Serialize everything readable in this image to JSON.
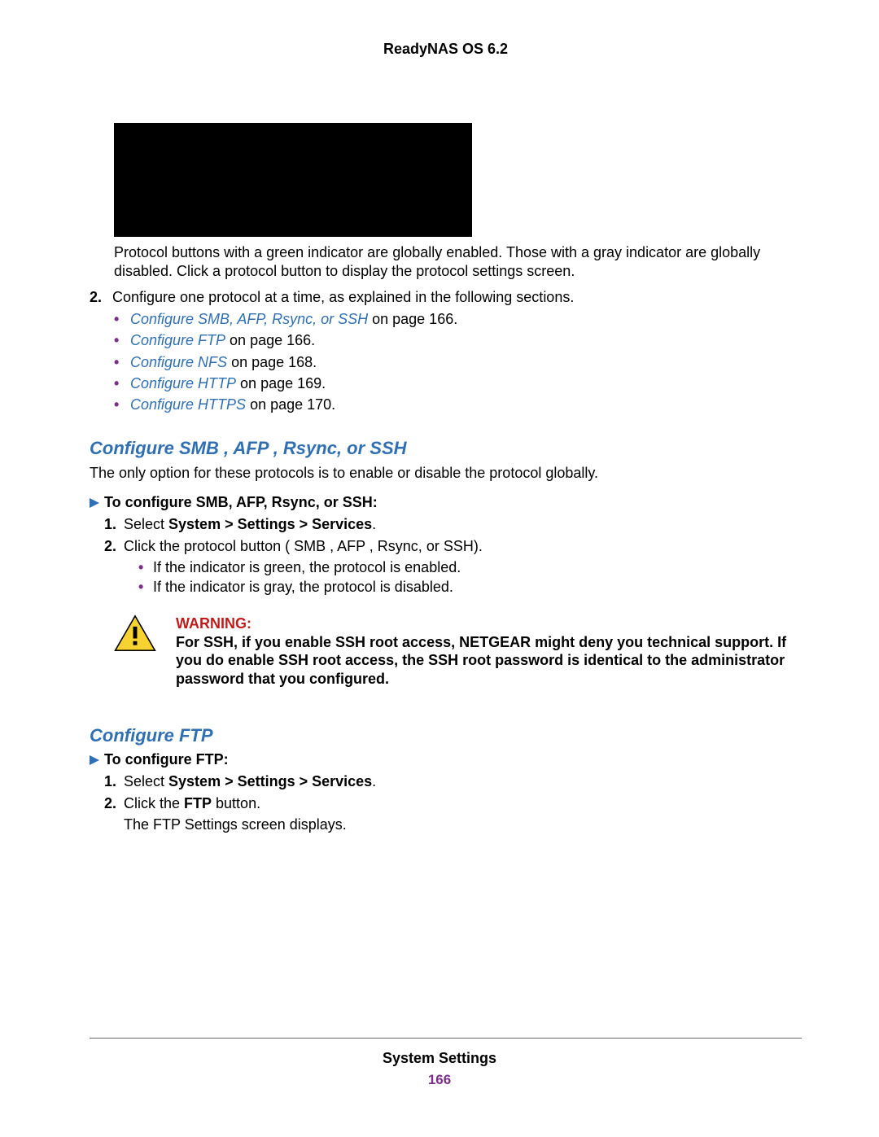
{
  "doc_title": "ReadyNAS OS 6.2",
  "caption": "Protocol buttons with a green indicator are globally enabled. Those with a gray indicator are globally disabled. Click a protocol button to display the protocol settings screen.",
  "step2": {
    "num": "2.",
    "text": "Configure one protocol at a time, as explained in the following sections."
  },
  "cross_refs": [
    {
      "link": "Configure SMB, AFP, Rsync, or SSH",
      "suffix": " on page 166."
    },
    {
      "link": "Configure FTP",
      "suffix": " on page 166."
    },
    {
      "link": "Configure NFS",
      "suffix": " on page 168."
    },
    {
      "link": "Configure HTTP",
      "suffix": " on page 169."
    },
    {
      "link": "Configure HTTPS",
      "suffix": " on page 170."
    }
  ],
  "section1": {
    "heading": "Configure SMB , AFP , Rsync, or SSH",
    "intro": "The only option for these protocols is to enable or disable the protocol globally.",
    "task_title": "To configure SMB, AFP, Rsync, or SSH:",
    "steps": [
      {
        "num": "1.",
        "pre": "Select ",
        "bold": "System > Settings > Services",
        "post": "."
      },
      {
        "num": "2.",
        "plain": "Click the protocol button ( SMB , AFP , Rsync, or SSH)."
      }
    ],
    "substeps": [
      "If the indicator is green, the protocol is enabled.",
      "If the indicator is gray, the protocol is disabled."
    ]
  },
  "warning": {
    "title": "WARNING:",
    "body": "For SSH, if you enable SSH root access, NETGEAR might deny you technical support. If you do enable SSH root access, the SSH root password is identical to the administrator password that you configured."
  },
  "section2": {
    "heading": "Configure FTP",
    "task_title": "To configure FTP:",
    "steps": [
      {
        "num": "1.",
        "pre": "Select ",
        "bold": "System > Settings > Services",
        "post": "."
      },
      {
        "num": "2.",
        "pre": "Click the ",
        "bold": "FTP",
        "post": " button."
      }
    ],
    "result": "The FTP Settings screen displays."
  },
  "footer": {
    "section": "System Settings",
    "page": "166"
  }
}
